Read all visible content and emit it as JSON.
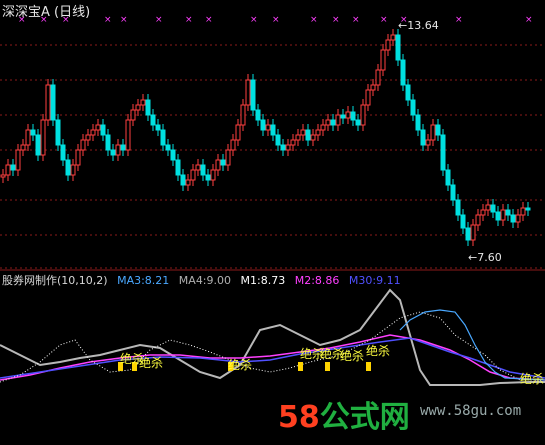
{
  "header": {
    "title": "深深宝A (日线)"
  },
  "indicator": {
    "name": "股券网制作(10,10,2)",
    "items": [
      {
        "label": "MA3:8.21",
        "color": "#4aa8ff"
      },
      {
        "label": "MA4:9.00",
        "color": "#b0b0b0"
      },
      {
        "label": "M1:8.73",
        "color": "#ffffff"
      },
      {
        "label": "M2:8.86",
        "color": "#ff40ff"
      },
      {
        "label": "M30:9.11",
        "color": "#5050ff"
      }
    ]
  },
  "annotations": {
    "high": "13.64",
    "low": "7.60"
  },
  "signal_text": "绝杀",
  "watermark": {
    "logo": "58公式网",
    "url": "www.58gu.com"
  },
  "colors": {
    "up": "#ff4040",
    "down": "#00e0e0",
    "grid": "#8a1a1a",
    "marker": "#ff40ff",
    "signal_bar": "#ffd400"
  }
}
